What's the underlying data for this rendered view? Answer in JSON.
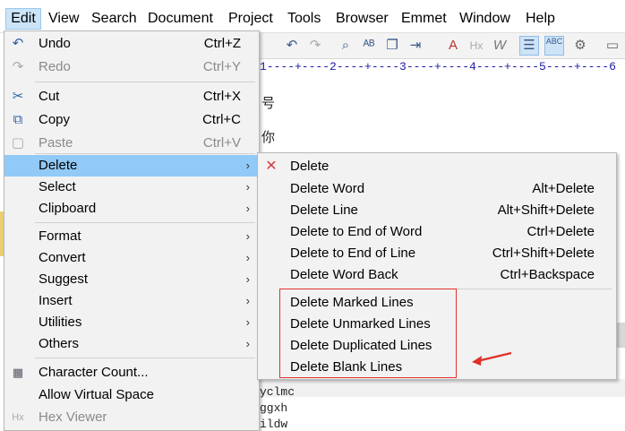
{
  "menubar": {
    "items": [
      "Edit",
      "View",
      "Search",
      "Document",
      "Project",
      "Tools",
      "Browser",
      "Emmet",
      "Window",
      "Help"
    ]
  },
  "ruler": "1----+----2----+----3----+----4----+----5----+----6",
  "editor": {
    "fragments": [
      "yclmc",
      "ggxh",
      "ildw"
    ],
    "side_chars": [
      "号",
      "你"
    ]
  },
  "edit_menu": {
    "items": [
      {
        "label": "Undo",
        "shortcut": "Ctrl+Z",
        "icon": "undo-icon",
        "disabled": false,
        "submenu": false
      },
      {
        "label": "Redo",
        "shortcut": "Ctrl+Y",
        "icon": "redo-icon",
        "disabled": true,
        "submenu": false
      },
      {
        "label": "Cut",
        "shortcut": "Ctrl+X",
        "icon": "scissors-icon",
        "disabled": false,
        "submenu": false
      },
      {
        "label": "Copy",
        "shortcut": "Ctrl+C",
        "icon": "copy-icon",
        "disabled": false,
        "submenu": false
      },
      {
        "label": "Paste",
        "shortcut": "Ctrl+V",
        "icon": "paste-icon",
        "disabled": true,
        "submenu": false
      },
      {
        "label": "Delete",
        "shortcut": "",
        "icon": "",
        "disabled": false,
        "submenu": true,
        "selected": true
      },
      {
        "label": "Select",
        "shortcut": "",
        "icon": "",
        "disabled": false,
        "submenu": true
      },
      {
        "label": "Clipboard",
        "shortcut": "",
        "icon": "",
        "disabled": false,
        "submenu": true
      },
      {
        "label": "Format",
        "shortcut": "",
        "icon": "",
        "disabled": false,
        "submenu": true
      },
      {
        "label": "Convert",
        "shortcut": "",
        "icon": "",
        "disabled": false,
        "submenu": true
      },
      {
        "label": "Suggest",
        "shortcut": "",
        "icon": "",
        "disabled": false,
        "submenu": true
      },
      {
        "label": "Insert",
        "shortcut": "",
        "icon": "",
        "disabled": false,
        "submenu": true
      },
      {
        "label": "Utilities",
        "shortcut": "",
        "icon": "",
        "disabled": false,
        "submenu": true
      },
      {
        "label": "Others",
        "shortcut": "",
        "icon": "",
        "disabled": false,
        "submenu": true
      },
      {
        "label": "Character Count...",
        "shortcut": "",
        "icon": "character-count-icon",
        "disabled": false,
        "submenu": false
      },
      {
        "label": "Allow Virtual Space",
        "shortcut": "",
        "icon": "",
        "disabled": false,
        "submenu": false
      },
      {
        "label": "Hex Viewer",
        "shortcut": "",
        "icon": "hex-icon",
        "disabled": true,
        "submenu": false
      }
    ]
  },
  "delete_submenu": {
    "items": [
      {
        "label": "Delete",
        "shortcut": "",
        "icon": "delete-x-icon"
      },
      {
        "label": "Delete Word",
        "shortcut": "Alt+Delete"
      },
      {
        "label": "Delete Line",
        "shortcut": "Alt+Shift+Delete"
      },
      {
        "label": "Delete to End of Word",
        "shortcut": "Ctrl+Delete"
      },
      {
        "label": "Delete to End of Line",
        "shortcut": "Ctrl+Shift+Delete"
      },
      {
        "label": "Delete Word Back",
        "shortcut": "Ctrl+Backspace"
      },
      {
        "label": "Delete Marked Lines",
        "shortcut": ""
      },
      {
        "label": "Delete Unmarked Lines",
        "shortcut": ""
      },
      {
        "label": "Delete Duplicated Lines",
        "shortcut": ""
      },
      {
        "label": "Delete Blank Lines",
        "shortcut": ""
      }
    ]
  },
  "colors": {
    "menu_bg": "#f2f2f2",
    "selected_item": "#91c9f7",
    "highlight_box": "#e0302c",
    "disabled_text": "#8a8a8a"
  }
}
